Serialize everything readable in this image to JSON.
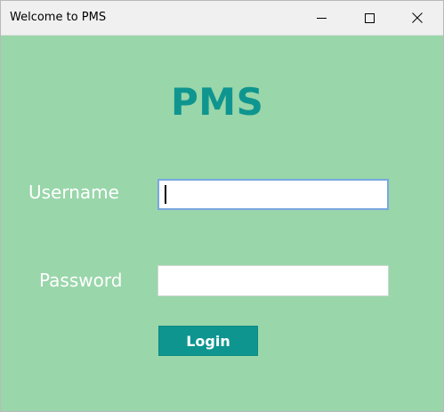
{
  "window": {
    "title": "Welcome to PMS",
    "controls": {
      "minimize_icon": "minimize-icon",
      "maximize_icon": "maximize-icon",
      "close_icon": "close-icon"
    }
  },
  "app": {
    "title": "PMS"
  },
  "form": {
    "username_label": "Username",
    "username_value": "",
    "password_label": "Password",
    "password_value": "",
    "login_label": "Login"
  },
  "colors": {
    "background": "#99d6aa",
    "accent": "#0f958f",
    "label_text": "#ffffff",
    "focus_border": "#7aa7e0"
  }
}
